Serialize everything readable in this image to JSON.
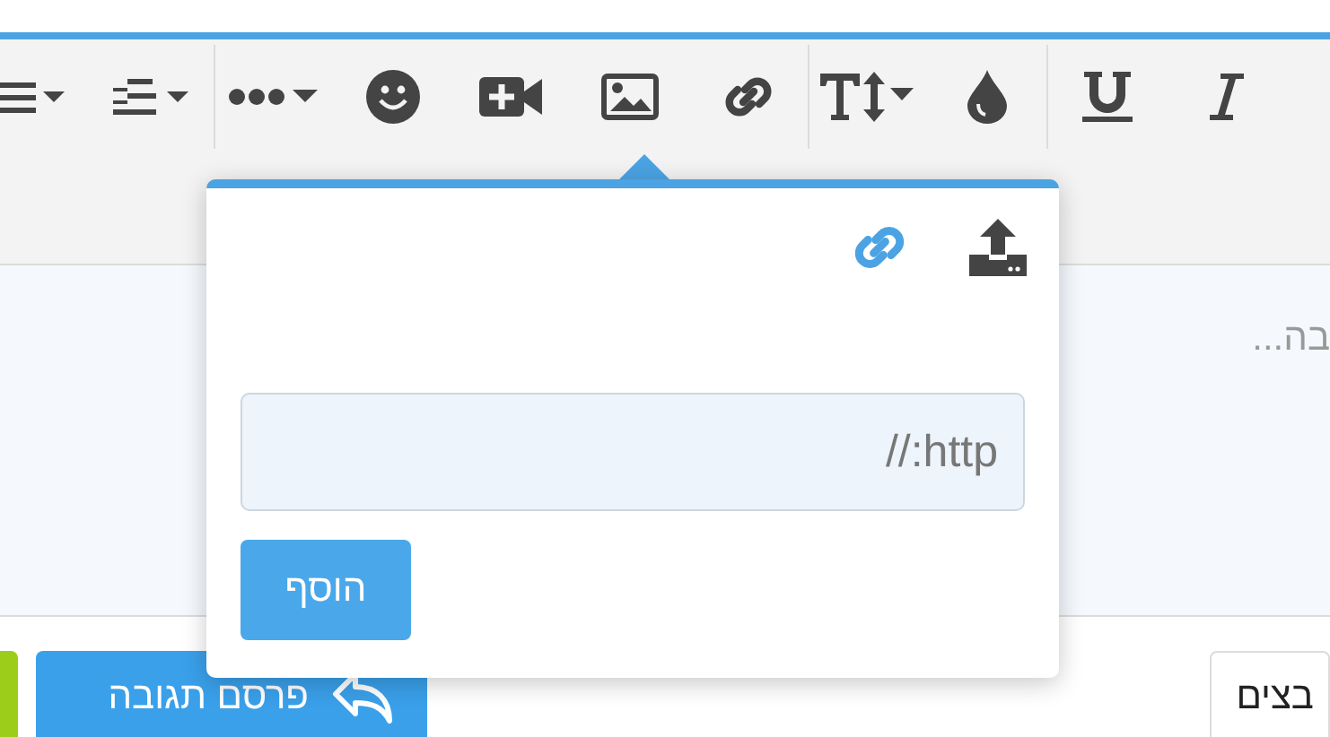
{
  "toolbar": {
    "tools": [
      {
        "kind": "list"
      },
      {
        "kind": "indent"
      },
      {
        "kind": "separator"
      },
      {
        "kind": "more"
      },
      {
        "kind": "smiley"
      },
      {
        "kind": "video"
      },
      {
        "kind": "image"
      },
      {
        "kind": "link"
      },
      {
        "kind": "separator"
      },
      {
        "kind": "textsize"
      },
      {
        "kind": "color"
      },
      {
        "kind": "separator"
      },
      {
        "kind": "underline"
      },
      {
        "kind": "italic"
      }
    ]
  },
  "editor": {
    "placeholder": "בה..."
  },
  "insert_popup": {
    "tabs": [
      {
        "kind": "upload",
        "selected": false
      },
      {
        "kind": "link",
        "selected": true
      }
    ],
    "url_field": {
      "placeholder": "http://"
    },
    "button": "הוסף"
  },
  "footer": {
    "post_button": "פרסם תגובה",
    "side_button": "בצים"
  }
}
